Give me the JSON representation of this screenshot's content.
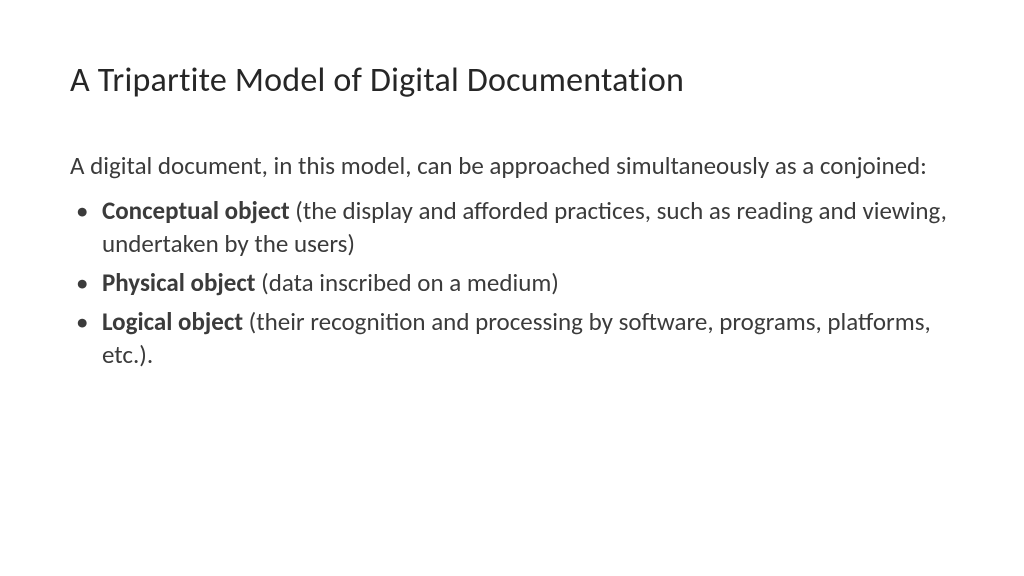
{
  "title": "A Tripartite Model of Digital Documentation",
  "intro": "A digital document, in this model, can be approached simultaneously as a conjoined:",
  "bullets": [
    {
      "bold": "Conceptual object",
      "rest": " (the display and afforded practices, such as reading and viewing, undertaken by the users)"
    },
    {
      "bold": "Physical object",
      "rest": " (data inscribed on a medium)"
    },
    {
      "bold": "Logical object",
      "rest": " (their recognition and processing by software, programs, platforms, etc.)."
    }
  ]
}
